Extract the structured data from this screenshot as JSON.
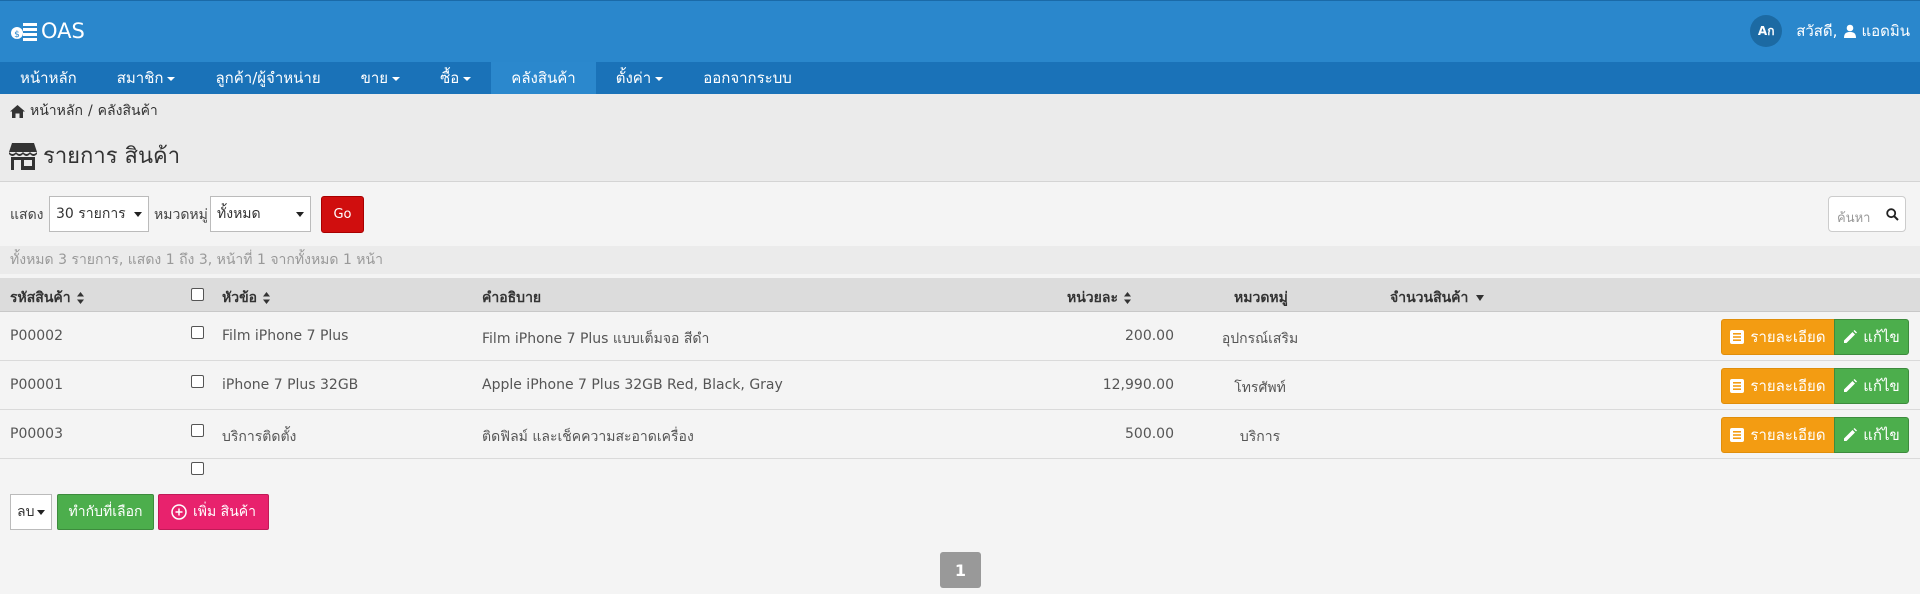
{
  "app": {
    "brand": "OAS"
  },
  "topbar": {
    "lang_label": "Aก",
    "greeting": "สวัสดี,",
    "username": "แอดมิน"
  },
  "nav": {
    "items": [
      {
        "label": "หน้าหลัก",
        "dropdown": false,
        "active": false
      },
      {
        "label": "สมาชิก",
        "dropdown": true,
        "active": false
      },
      {
        "label": "ลูกค้า/ผู้จำหน่าย",
        "dropdown": false,
        "active": false
      },
      {
        "label": "ขาย",
        "dropdown": true,
        "active": false
      },
      {
        "label": "ซื้อ",
        "dropdown": true,
        "active": false
      },
      {
        "label": "คลังสินค้า",
        "dropdown": false,
        "active": true
      },
      {
        "label": "ตั้งค่า",
        "dropdown": true,
        "active": false
      },
      {
        "label": "ออกจากระบบ",
        "dropdown": false,
        "active": false
      }
    ]
  },
  "breadcrumb": {
    "home": "หน้าหลัก",
    "separator": "/",
    "current": "คลังสินค้า"
  },
  "page": {
    "title": "รายการ สินค้า"
  },
  "filters": {
    "show_label": "แสดง",
    "show_value": "30 รายการ",
    "category_label": "หมวดหมู่",
    "category_value": "ทั้งหมด",
    "go_label": "Go",
    "search_placeholder": "ค้นหา"
  },
  "summary": "ทั้งหมด 3 รายการ, แสดง 1 ถึง 3, หน้าที่ 1 จากทั้งหมด 1 หน้า",
  "table": {
    "headers": {
      "code": "รหัสสินค้า",
      "title": "หัวข้อ",
      "description": "คำอธิบาย",
      "unit_price": "หน่วยละ",
      "category": "หมวดหมู่",
      "quantity": "จำนวนสินค้า"
    },
    "rows": [
      {
        "code": "P00002",
        "title": "Film iPhone 7 Plus",
        "description": "Film iPhone 7 Plus แบบเต็มจอ สีดำ",
        "unit_price": "200.00",
        "category": "อุปกรณ์เสริม",
        "quantity": ""
      },
      {
        "code": "P00001",
        "title": "iPhone 7 Plus 32GB",
        "description": "Apple iPhone 7 Plus 32GB Red, Black, Gray",
        "unit_price": "12,990.00",
        "category": "โทรศัพท์",
        "quantity": ""
      },
      {
        "code": "P00003",
        "title": "บริการติดตั้ง",
        "description": "ติดฟิลม์ และเช็คความสะอาดเครื่อง",
        "unit_price": "500.00",
        "category": "บริการ",
        "quantity": ""
      }
    ],
    "detail_label": "รายละเอียด",
    "edit_label": "แก้ไข"
  },
  "actions": {
    "bulk_value": "ลบ",
    "apply_label": "ทำกับที่เลือก",
    "add_label": "เพิ่ม สินค้า"
  },
  "pagination": {
    "current_page": "1"
  },
  "colors": {
    "topbar": "#2a87cc",
    "navbar": "#1a72b8",
    "danger": "#d00e0e",
    "warning": "#f39c12",
    "success": "#4cae4c",
    "pink": "#e8226d"
  }
}
